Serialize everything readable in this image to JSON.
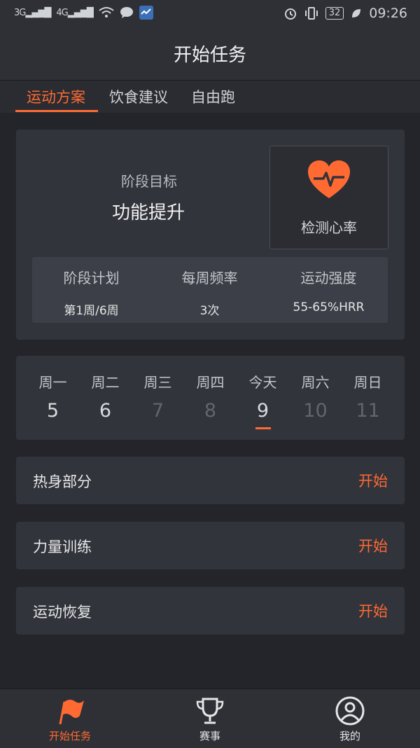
{
  "status_bar": {
    "signal1": "3G",
    "signal2": "4G",
    "battery": "32",
    "time": "09:26"
  },
  "header": {
    "title": "开始任务"
  },
  "tabs": [
    {
      "label": "运动方案",
      "active": true
    },
    {
      "label": "饮食建议",
      "active": false
    },
    {
      "label": "自由跑",
      "active": false
    }
  ],
  "goal": {
    "label": "阶段目标",
    "value": "功能提升",
    "heart_rate_label": "检测心率"
  },
  "plan": [
    {
      "title": "阶段计划",
      "value": "第1周/6周"
    },
    {
      "title": "每周频率",
      "value": "3次"
    },
    {
      "title": "运动强度",
      "value": "55-65%HRR"
    }
  ],
  "week": [
    {
      "name": "周一",
      "num": "5"
    },
    {
      "name": "周二",
      "num": "6"
    },
    {
      "name": "周三",
      "num": "7"
    },
    {
      "name": "周四",
      "num": "8"
    },
    {
      "name": "今天",
      "num": "9"
    },
    {
      "name": "周六",
      "num": "10"
    },
    {
      "name": "周日",
      "num": "11"
    }
  ],
  "tasks": [
    {
      "name": "热身部分",
      "action": "开始"
    },
    {
      "name": "力量训练",
      "action": "开始"
    },
    {
      "name": "运动恢复",
      "action": "开始"
    }
  ],
  "bottom_nav": [
    {
      "label": "开始任务",
      "icon": "flag-icon",
      "active": true
    },
    {
      "label": "赛事",
      "icon": "trophy-icon",
      "active": false
    },
    {
      "label": "我的",
      "icon": "user-icon",
      "active": false
    }
  ],
  "colors": {
    "accent": "#ff6a33",
    "background": "#23252b",
    "card": "#32343b"
  }
}
